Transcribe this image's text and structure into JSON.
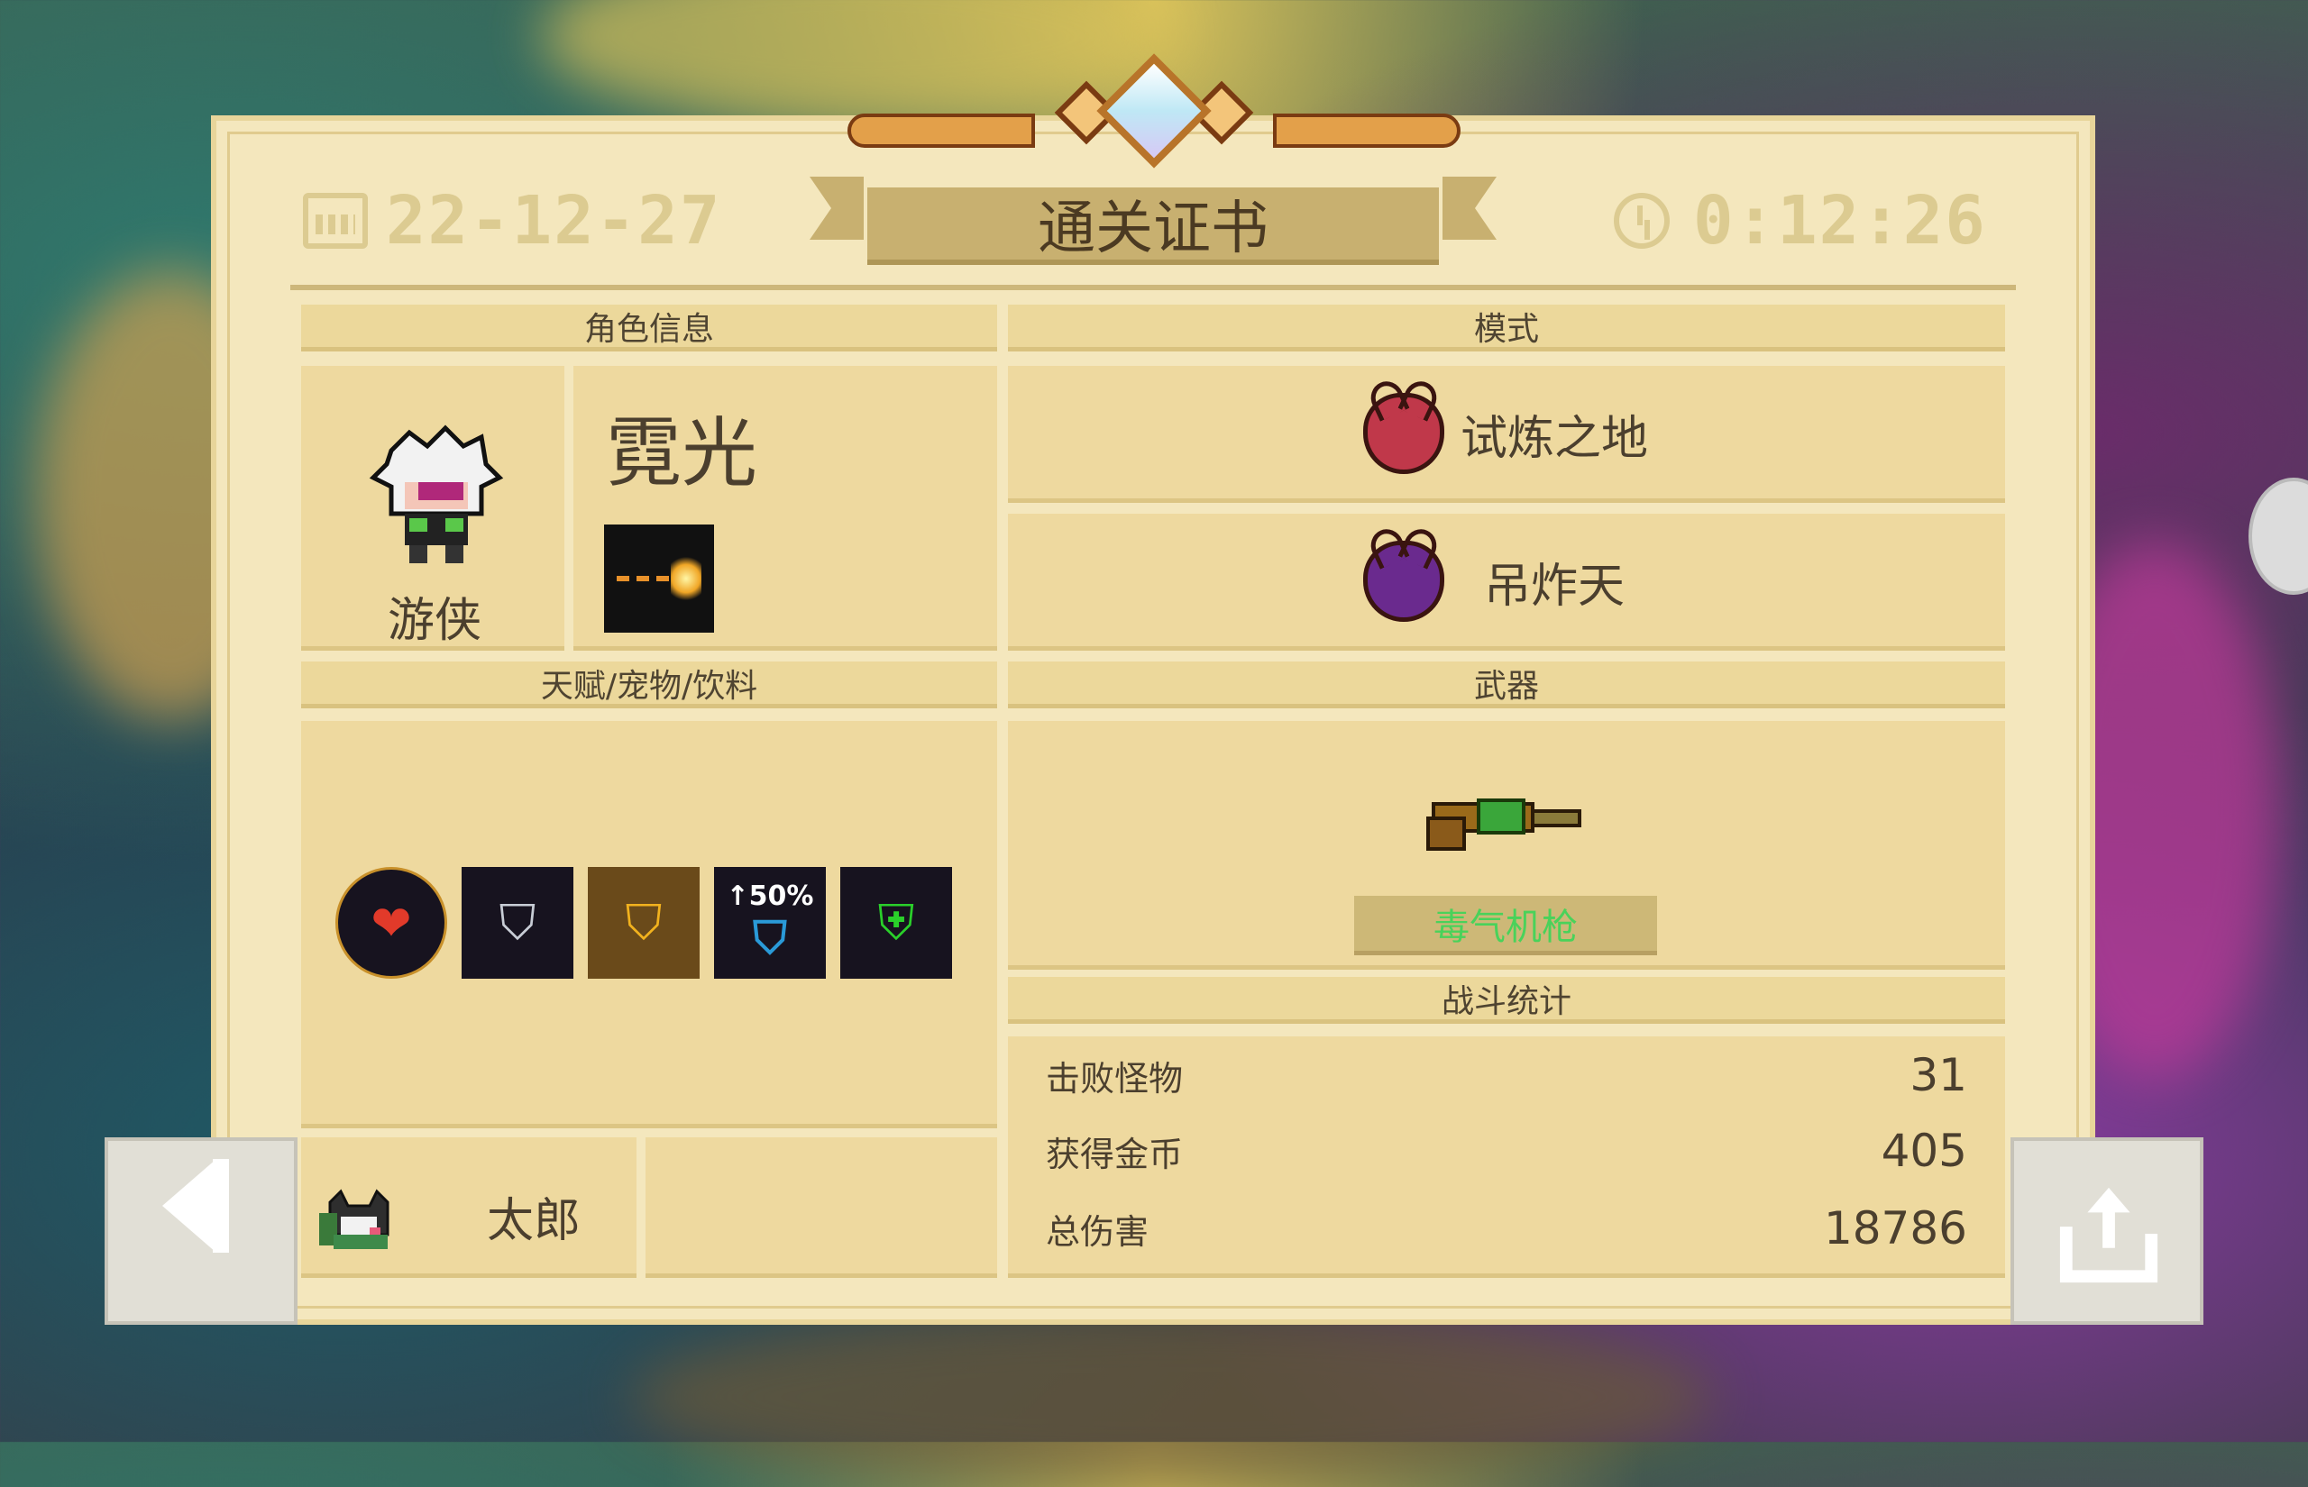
{
  "header": {
    "date": "22-12-27",
    "title": "通关证书",
    "time": "0:12:26"
  },
  "sections": {
    "character_info": "角色信息",
    "mode": "模式",
    "talents_pets_drinks": "天赋/宠物/饮料",
    "weapon": "武器",
    "battle_stats": "战斗统计"
  },
  "character": {
    "name": "霓光",
    "class": "游侠",
    "skill_icon": "laser-burst-icon"
  },
  "modes": [
    {
      "label": "试炼之地",
      "icon": "red-demon-helmet-icon",
      "color": "#c0384a"
    },
    {
      "label": "吊炸天",
      "icon": "purple-demon-helmet-icon",
      "color": "#6a2a8e"
    }
  ],
  "talents": [
    {
      "icon": "heart-plus-icon",
      "glyph": "❤"
    },
    {
      "icon": "silver-shield-icon",
      "glyph": "⛉"
    },
    {
      "icon": "gold-shield-icon",
      "glyph": "⛉"
    },
    {
      "icon": "shield-50-percent-icon",
      "glyph": "↑50%"
    },
    {
      "icon": "green-shield-icon",
      "glyph": "⛨"
    }
  ],
  "weapon": {
    "name": "毒气机枪",
    "name_color": "#49d25a"
  },
  "stats": [
    {
      "label": "击败怪物",
      "value": "31"
    },
    {
      "label": "获得金币",
      "value": "405"
    },
    {
      "label": "总伤害",
      "value": "18786"
    }
  ],
  "pet": {
    "name": "太郎",
    "icon": "cat-pet-icon"
  }
}
